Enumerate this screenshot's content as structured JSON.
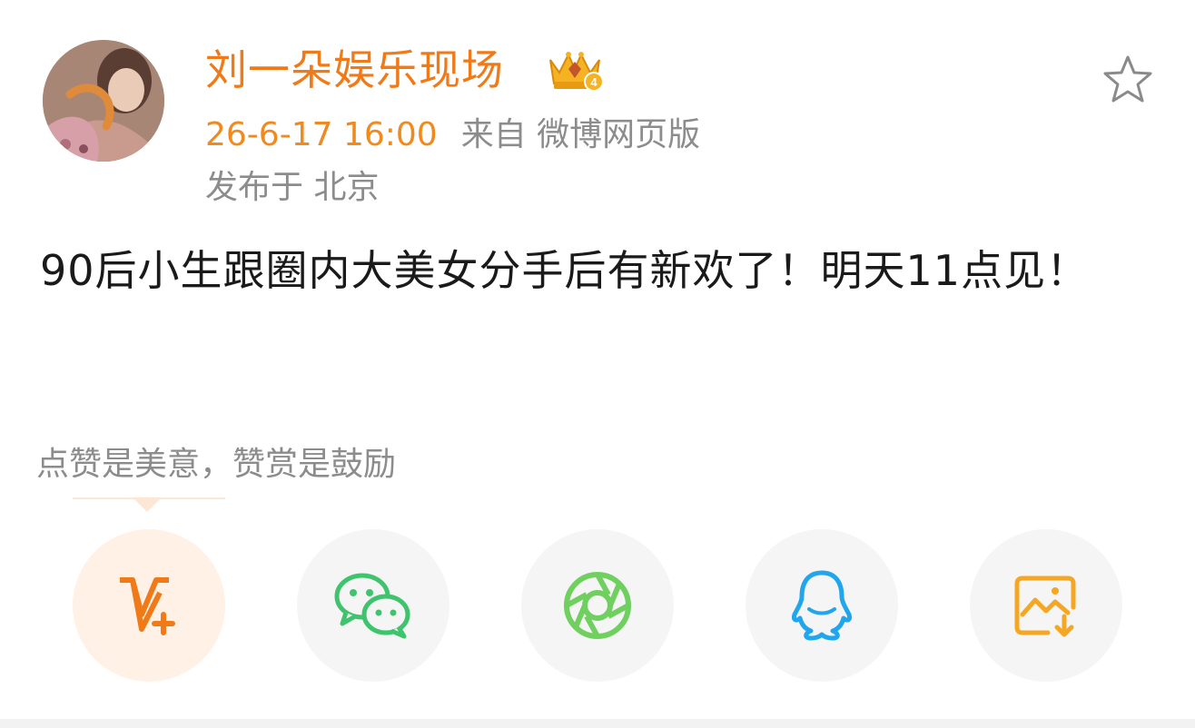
{
  "post": {
    "user_name": "刘一朵娱乐现场",
    "time": "26-6-17 16:00",
    "source": "来自 微博网页版",
    "location": "发布于 北京",
    "text": "90后小生跟圈内大美女分手后有新欢了！明天11点见！"
  },
  "reward": {
    "hint": "点赞是美意，赞赏是鼓励"
  },
  "colors": {
    "accent": "#f07a17",
    "wechat": "#3fc46d",
    "moments": "#6fcf5f",
    "qq": "#21a6ee",
    "save": "#f5a623"
  },
  "share_buttons": [
    {
      "icon": "reward-v-plus-icon"
    },
    {
      "icon": "wechat-icon"
    },
    {
      "icon": "moments-icon"
    },
    {
      "icon": "qq-icon"
    },
    {
      "icon": "save-image-icon"
    }
  ]
}
